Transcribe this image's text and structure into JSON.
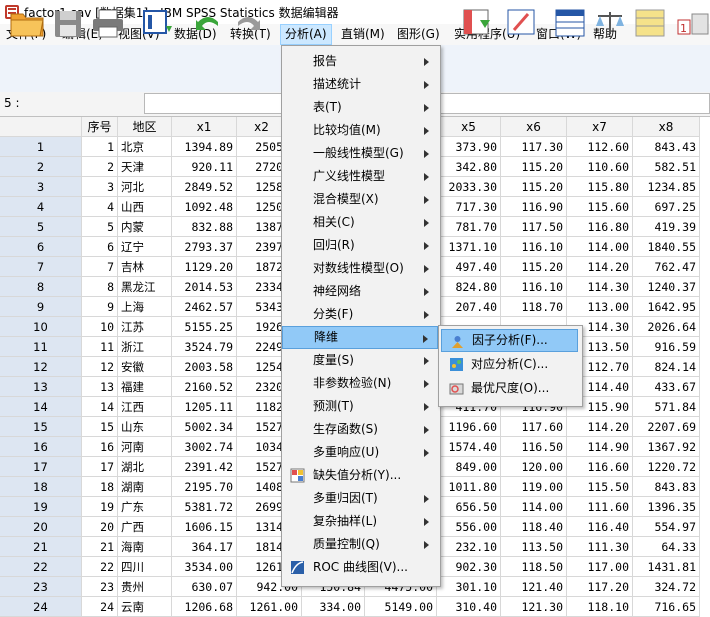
{
  "window": {
    "title": "factor1.sav [数据集1] - IBM SPSS Statistics 数据编辑器"
  },
  "menubar": [
    "文件(F)",
    "编辑(E)",
    "视图(V)",
    "数据(D)",
    "转换(T)",
    "分析(A)",
    "直销(M)",
    "图形(G)",
    "实用程序(U)",
    "窗口(W)",
    "帮助"
  ],
  "active_menu": "分析(A)",
  "cell_editor": {
    "ref": "5 :",
    "value": ""
  },
  "grid": {
    "columns": [
      "序号",
      "地区",
      "x1",
      "x2",
      "x5",
      "x6",
      "x7",
      "x8"
    ],
    "rows": [
      {
        "n": "1",
        "seq": "1",
        "region": "北京",
        "x1": "1394.89",
        "x2": "2505",
        "x5": "373.90",
        "x6": "117.30",
        "x7": "112.60",
        "x8": "843.43"
      },
      {
        "n": "2",
        "seq": "2",
        "region": "天津",
        "x1": "920.11",
        "x2": "2720",
        "x5": "342.80",
        "x6": "115.20",
        "x7": "110.60",
        "x8": "582.51"
      },
      {
        "n": "3",
        "seq": "3",
        "region": "河北",
        "x1": "2849.52",
        "x2": "1258",
        "x5": "2033.30",
        "x6": "115.20",
        "x7": "115.80",
        "x8": "1234.85"
      },
      {
        "n": "4",
        "seq": "4",
        "region": "山西",
        "x1": "1092.48",
        "x2": "1250",
        "x5": "717.30",
        "x6": "116.90",
        "x7": "115.60",
        "x8": "697.25"
      },
      {
        "n": "5",
        "seq": "5",
        "region": "内蒙",
        "x1": "832.88",
        "x2": "1387",
        "x5": "781.70",
        "x6": "117.50",
        "x7": "116.80",
        "x8": "419.39"
      },
      {
        "n": "6",
        "seq": "6",
        "region": "辽宁",
        "x1": "2793.37",
        "x2": "2397",
        "x5": "1371.10",
        "x6": "116.10",
        "x7": "114.00",
        "x8": "1840.55"
      },
      {
        "n": "7",
        "seq": "7",
        "region": "吉林",
        "x1": "1129.20",
        "x2": "1872",
        "x5": "497.40",
        "x6": "115.20",
        "x7": "114.20",
        "x8": "762.47"
      },
      {
        "n": "8",
        "seq": "8",
        "region": "黑龙江",
        "x1": "2014.53",
        "x2": "2334",
        "x5": "824.80",
        "x6": "116.10",
        "x7": "114.30",
        "x8": "1240.37"
      },
      {
        "n": "9",
        "seq": "9",
        "region": "上海",
        "x1": "2462.57",
        "x2": "5343",
        "x5": "207.40",
        "x6": "118.70",
        "x7": "113.00",
        "x8": "1642.95"
      },
      {
        "n": "10",
        "seq": "10",
        "region": "江苏",
        "x1": "5155.25",
        "x2": "1926",
        "x5": "",
        "x6": "",
        "x7": "114.30",
        "x8": "2026.64"
      },
      {
        "n": "11",
        "seq": "11",
        "region": "浙江",
        "x1": "3524.79",
        "x2": "2249",
        "x5": "",
        "x6": "",
        "x7": "113.50",
        "x8": "916.59"
      },
      {
        "n": "12",
        "seq": "12",
        "region": "安徽",
        "x1": "2003.58",
        "x2": "1254",
        "x5": "",
        "x6": "",
        "x7": "112.70",
        "x8": "824.14"
      },
      {
        "n": "13",
        "seq": "13",
        "region": "福建",
        "x1": "2160.52",
        "x2": "2320",
        "x5": "",
        "x6": "",
        "x7": "114.40",
        "x8": "433.67"
      },
      {
        "n": "14",
        "seq": "14",
        "region": "江西",
        "x1": "1205.11",
        "x2": "1182",
        "x5": "411.70",
        "x6": "116.90",
        "x7": "115.90",
        "x8": "571.84"
      },
      {
        "n": "15",
        "seq": "15",
        "region": "山东",
        "x1": "5002.34",
        "x2": "1527",
        "x5": "1196.60",
        "x6": "117.60",
        "x7": "114.20",
        "x8": "2207.69"
      },
      {
        "n": "16",
        "seq": "16",
        "region": "河南",
        "x1": "3002.74",
        "x2": "1034",
        "x5": "1574.40",
        "x6": "116.50",
        "x7": "114.90",
        "x8": "1367.92"
      },
      {
        "n": "17",
        "seq": "17",
        "region": "湖北",
        "x1": "2391.42",
        "x2": "1527",
        "x5": "849.00",
        "x6": "120.00",
        "x7": "116.60",
        "x8": "1220.72"
      },
      {
        "n": "18",
        "seq": "18",
        "region": "湖南",
        "x1": "2195.70",
        "x2": "1408",
        "x5": "1011.80",
        "x6": "119.00",
        "x7": "115.50",
        "x8": "843.83"
      },
      {
        "n": "19",
        "seq": "19",
        "region": "广东",
        "x1": "5381.72",
        "x2": "2699",
        "x5": "656.50",
        "x6": "114.00",
        "x7": "111.60",
        "x8": "1396.35"
      },
      {
        "n": "20",
        "seq": "20",
        "region": "广西",
        "x1": "1606.15",
        "x2": "1314",
        "x5": "556.00",
        "x6": "118.40",
        "x7": "116.40",
        "x8": "554.97"
      },
      {
        "n": "21",
        "seq": "21",
        "region": "海南",
        "x1": "364.17",
        "x2": "1814",
        "x5": "232.10",
        "x6": "113.50",
        "x7": "111.30",
        "x8": "64.33"
      },
      {
        "n": "22",
        "seq": "22",
        "region": "四川",
        "x1": "3534.00",
        "x2": "1261",
        "x5": "902.30",
        "x6": "118.50",
        "x7": "117.00",
        "x8": "1431.81"
      },
      {
        "n": "23",
        "seq": "23",
        "region": "贵州",
        "x1": "630.07",
        "x2": "942.00",
        "x3": "150.84",
        "x4": "4475.00",
        "x5": "301.10",
        "x6": "121.40",
        "x7": "117.20",
        "x8": "324.72"
      },
      {
        "n": "24",
        "seq": "24",
        "region": "云南",
        "x1": "1206.68",
        "x2": "1261.00",
        "x3": "334.00",
        "x4": "5149.00",
        "x5": "310.40",
        "x6": "121.30",
        "x7": "118.10",
        "x8": "716.65"
      }
    ]
  },
  "analyze_menu": [
    {
      "label": "报告",
      "submenu": true
    },
    {
      "label": "描述统计",
      "submenu": true
    },
    {
      "label": "表(T)",
      "submenu": true
    },
    {
      "label": "比较均值(M)",
      "submenu": true
    },
    {
      "label": "一般线性模型(G)",
      "submenu": true
    },
    {
      "label": "广义线性模型",
      "submenu": true
    },
    {
      "label": "混合模型(X)",
      "submenu": true
    },
    {
      "label": "相关(C)",
      "submenu": true
    },
    {
      "label": "回归(R)",
      "submenu": true
    },
    {
      "label": "对数线性模型(O)",
      "submenu": true
    },
    {
      "label": "神经网络",
      "submenu": true
    },
    {
      "label": "分类(F)",
      "submenu": true
    },
    {
      "label": "降维",
      "submenu": true,
      "highlighted": true
    },
    {
      "label": "度量(S)",
      "submenu": true
    },
    {
      "label": "非参数检验(N)",
      "submenu": true
    },
    {
      "label": "预测(T)",
      "submenu": true
    },
    {
      "label": "生存函数(S)",
      "submenu": true
    },
    {
      "label": "多重响应(U)",
      "submenu": true
    },
    {
      "label": "缺失值分析(Y)...",
      "submenu": false,
      "icon": "missing-value-icon"
    },
    {
      "label": "多重归因(T)",
      "submenu": true
    },
    {
      "label": "复杂抽样(L)",
      "submenu": true
    },
    {
      "label": "质量控制(Q)",
      "submenu": true
    },
    {
      "label": "ROC 曲线图(V)...",
      "submenu": false,
      "icon": "roc-curve-icon"
    }
  ],
  "reduction_submenu": [
    {
      "label": "因子分析(F)...",
      "icon": "factor-analysis-icon",
      "highlighted": true
    },
    {
      "label": "对应分析(C)...",
      "icon": "correspondence-analysis-icon"
    },
    {
      "label": "最优尺度(O)...",
      "icon": "optimal-scaling-icon"
    }
  ]
}
